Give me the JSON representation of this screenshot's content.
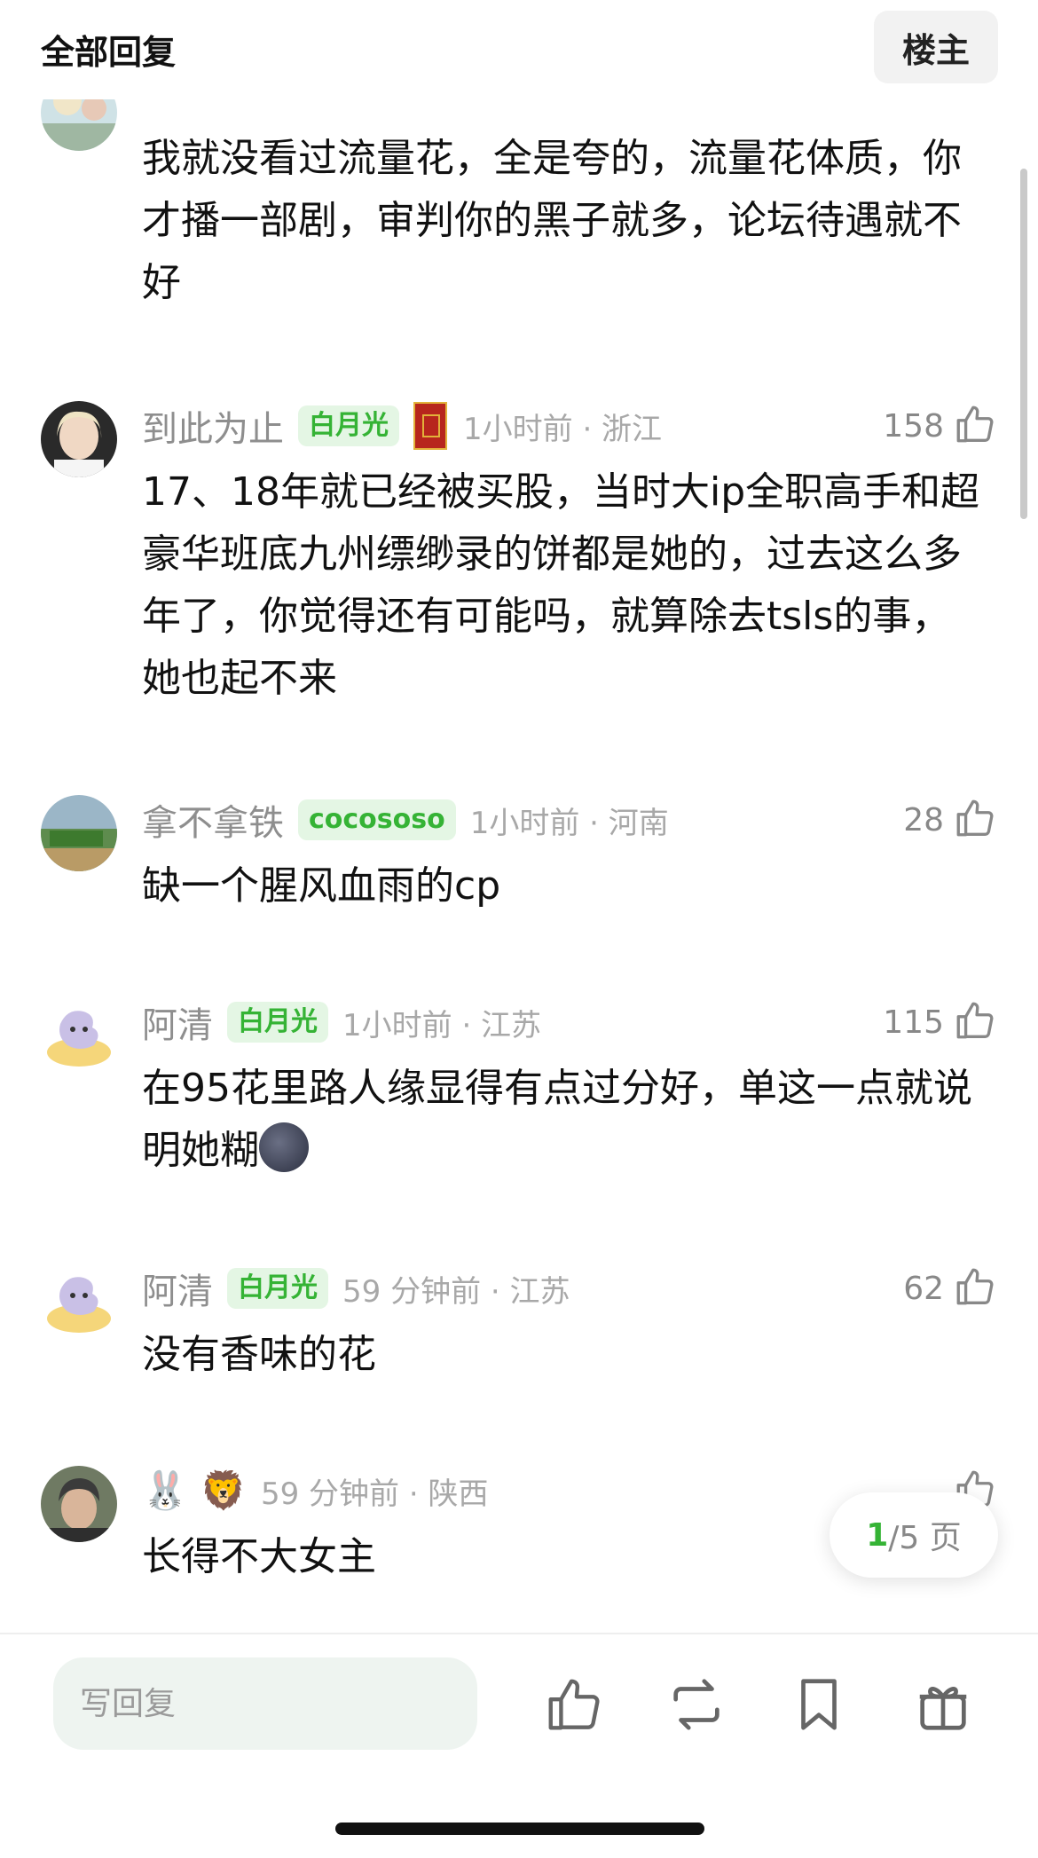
{
  "header": {
    "title": "全部回复",
    "owner_button": "楼主"
  },
  "comments": [
    {
      "username": "",
      "time_location": "",
      "likes": "",
      "text": "我就没看过流量花，全是夸的，流量花体质，你才播一部剧，审判你的黑子就多，论坛待遇就不好"
    },
    {
      "username": "到此为止",
      "badge": "白月光",
      "time_location": "1小时前 · 浙江",
      "likes": "158",
      "text": "17、18年就已经被买股，当时大ip全职高手和超豪华班底九州缥缈录的饼都是她的，过去这么多年了，你觉得还有可能吗，就算除去tsls的事，她也起不来"
    },
    {
      "username": "拿不拿铁",
      "badge": "cocososo",
      "time_location": "1小时前 · 河南",
      "likes": "28",
      "text": "缺一个腥风血雨的cp"
    },
    {
      "username": "阿清",
      "badge": "白月光",
      "time_location": "1小时前 · 江苏",
      "likes": "115",
      "text": "在95花里路人缘显得有点过分好，单这一点就说明她糊"
    },
    {
      "username": "阿清",
      "badge": "白月光",
      "time_location": "59 分钟前 · 江苏",
      "likes": "62",
      "text": "没有香味的花"
    },
    {
      "username": "🐰 🦁",
      "time_location": "59 分钟前 · 陕西",
      "likes": "",
      "text": "长得不大女主"
    }
  ],
  "pagination": {
    "current": "1",
    "suffix": "/5 页"
  },
  "bottom_bar": {
    "reply_placeholder": "写回复"
  },
  "colors": {
    "accent": "#35b335",
    "badge_bg": "#e4f6e4",
    "muted": "#8e8e8e"
  }
}
